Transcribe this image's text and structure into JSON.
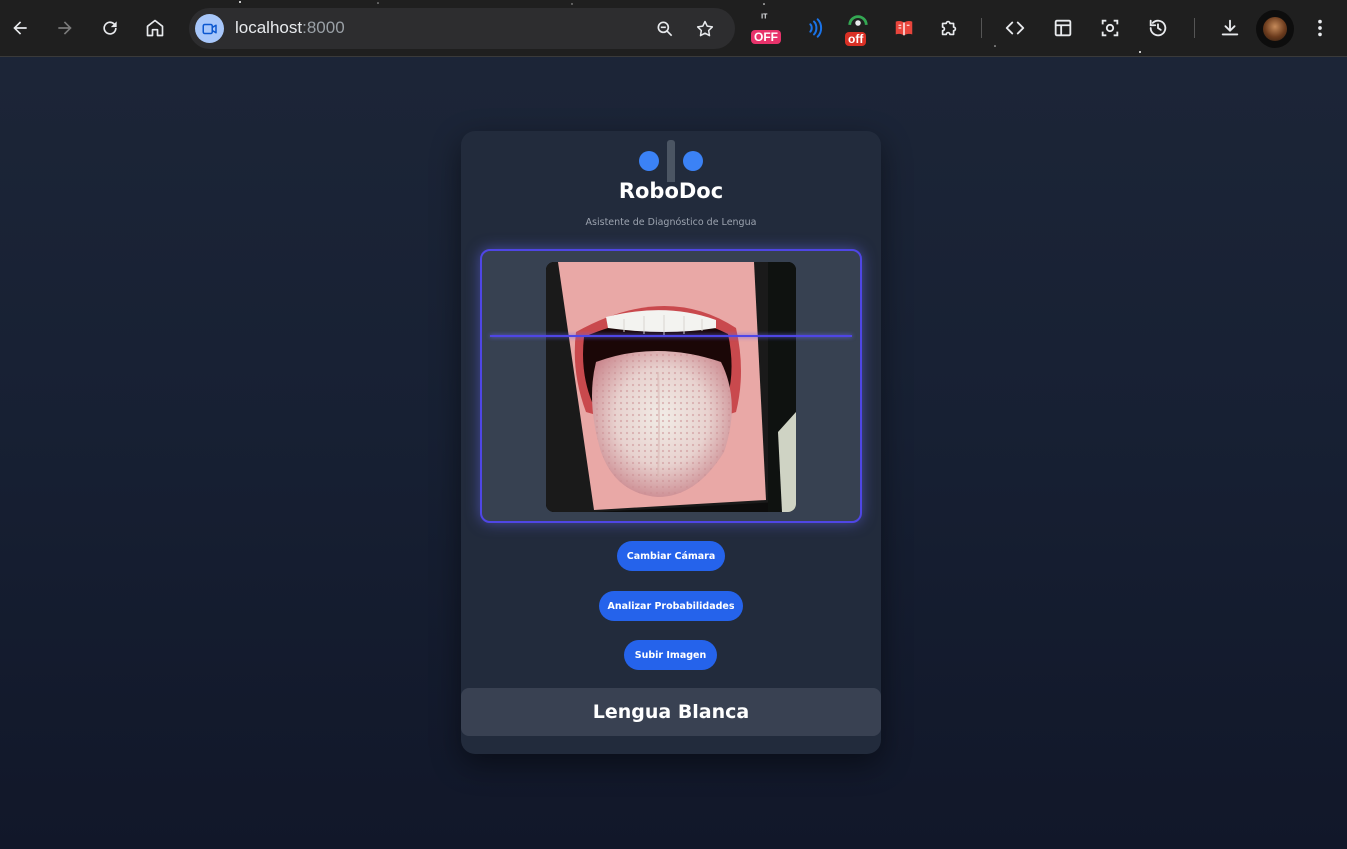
{
  "browser": {
    "url_host": "localhost",
    "url_port": ":8000",
    "icons": {
      "back": "arrow-left-icon",
      "forward": "arrow-right-icon",
      "reload": "reload-icon",
      "home": "home-icon",
      "site_info": "video-camera-icon",
      "zoom": "zoom-out-icon",
      "bookmark": "star-icon"
    },
    "extensions": [
      {
        "name": "ext-it-off",
        "badge": "OFF",
        "badge_color": "#e8336b"
      },
      {
        "name": "ext-wifi",
        "badge": "",
        "badge_color": "#1a73e8"
      },
      {
        "name": "ext-green-off",
        "badge": "off",
        "badge_color": "#d93025"
      },
      {
        "name": "ext-book",
        "badge": "",
        "badge_color": "#e8453c"
      }
    ],
    "toolbar_icons": [
      "puzzle-icon",
      "code-icon",
      "layout-icon",
      "screenshot-icon",
      "history-icon",
      "download-icon",
      "avatar",
      "more-icon"
    ]
  },
  "app": {
    "title": "RoboDoc",
    "subtitle": "Asistente de Diagnóstico de Lengua",
    "buttons": {
      "switch_camera": "Cambiar Cámara",
      "analyze": "Analizar Probabilidades",
      "upload": "Subir Imagen"
    },
    "result": "Lengua Blanca",
    "colors": {
      "accent": "#2563eb",
      "scan_line": "#4f46e5",
      "card_bg": "#222b3c",
      "page_bg": "#1d2638"
    }
  }
}
